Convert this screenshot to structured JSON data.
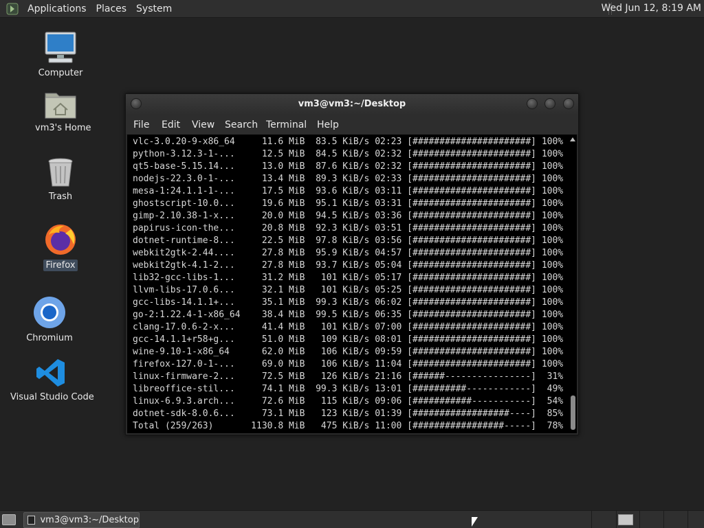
{
  "top_panel": {
    "menus": [
      "Applications",
      "Places",
      "System"
    ],
    "clock": "Wed Jun 12,  8:19 AM"
  },
  "desktop_icons": [
    {
      "label": "Computer",
      "icon": "computer-icon"
    },
    {
      "label": "vm3's Home",
      "icon": "home-folder-icon"
    },
    {
      "label": "Trash",
      "icon": "trash-icon"
    },
    {
      "label": "Firefox",
      "icon": "firefox-icon",
      "selected": true
    },
    {
      "label": "Chromium",
      "icon": "chromium-icon"
    },
    {
      "label": "Visual Studio Code",
      "icon": "vscode-icon"
    }
  ],
  "terminal": {
    "title": "vm3@vm3:~/Desktop",
    "menu": [
      "File",
      "Edit",
      "View",
      "Search",
      "Terminal",
      "Help"
    ],
    "lines": [
      "vlc-3.0.20-9-x86_64     11.6 MiB  83.5 KiB/s 02:23 [######################] 100%",
      "python-3.12.3-1-...     12.5 MiB  84.5 KiB/s 02:32 [######################] 100%",
      "qt5-base-5.15.14...     13.0 MiB  87.6 KiB/s 02:32 [######################] 100%",
      "nodejs-22.3.0-1-...     13.4 MiB  89.3 KiB/s 02:33 [######################] 100%",
      "mesa-1:24.1.1-1-...     17.5 MiB  93.6 KiB/s 03:11 [######################] 100%",
      "ghostscript-10.0...     19.6 MiB  95.1 KiB/s 03:31 [######################] 100%",
      "gimp-2.10.38-1-x...     20.0 MiB  94.5 KiB/s 03:36 [######################] 100%",
      "papirus-icon-the...     20.8 MiB  92.3 KiB/s 03:51 [######################] 100%",
      "dotnet-runtime-8...     22.5 MiB  97.8 KiB/s 03:56 [######################] 100%",
      "webkit2gtk-2.44....     27.8 MiB  95.9 KiB/s 04:57 [######################] 100%",
      "webkit2gtk-4.1-2...     27.8 MiB  93.7 KiB/s 05:04 [######################] 100%",
      "lib32-gcc-libs-1...     31.2 MiB   101 KiB/s 05:17 [######################] 100%",
      "llvm-libs-17.0.6...     32.1 MiB   101 KiB/s 05:25 [######################] 100%",
      "gcc-libs-14.1.1+...     35.1 MiB  99.3 KiB/s 06:02 [######################] 100%",
      "go-2:1.22.4-1-x86_64    38.4 MiB  99.5 KiB/s 06:35 [######################] 100%",
      "clang-17.0.6-2-x...     41.4 MiB   101 KiB/s 07:00 [######################] 100%",
      "gcc-14.1.1+r58+g...     51.0 MiB   109 KiB/s 08:01 [######################] 100%",
      "wine-9.10-1-x86_64      62.0 MiB   106 KiB/s 09:59 [######################] 100%",
      "firefox-127.0-1-...     69.0 MiB   106 KiB/s 11:04 [######################] 100%",
      "linux-firmware-2...     72.5 MiB   126 KiB/s 21:16 [######----------------]  31%",
      "libreoffice-stil...     74.1 MiB  99.3 KiB/s 13:01 [##########------------]  49%",
      "linux-6.9.3.arch...     72.6 MiB   115 KiB/s 09:06 [###########-----------]  54%",
      "dotnet-sdk-8.0.6...     73.1 MiB   123 KiB/s 01:39 [##################----]  85%",
      "Total (259/263)       1130.8 MiB   475 KiB/s 11:00 [#################-----]  78%"
    ]
  },
  "taskbar": {
    "window_title": "vm3@vm3:~/Desktop"
  }
}
